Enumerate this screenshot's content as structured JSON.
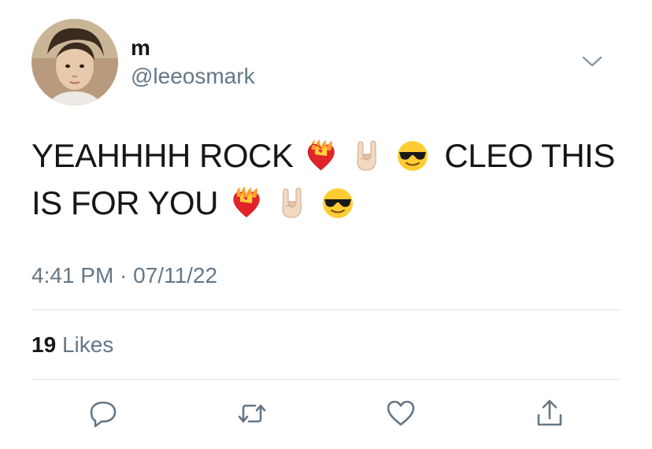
{
  "author": {
    "display_name": "m",
    "handle": "@leeosmark"
  },
  "tweet": {
    "line1_text": "YEAHHHH ROCK",
    "line1_trailing": "CLEO THIS",
    "line2_text": "IS FOR YOU",
    "emojis": [
      "heart-on-fire",
      "sign-of-horns-light-skin",
      "smiling-face-with-sunglasses"
    ]
  },
  "meta": {
    "timestamp": "4:41 PM · 07/11/22"
  },
  "stats": {
    "likes_count": "19",
    "likes_label": "Likes"
  },
  "actions": {
    "icons": [
      "reply-icon",
      "retweet-icon",
      "like-icon",
      "share-icon"
    ]
  },
  "colors": {
    "text": "#14171a",
    "secondary": "#657786",
    "divider": "#dfe3e6"
  }
}
